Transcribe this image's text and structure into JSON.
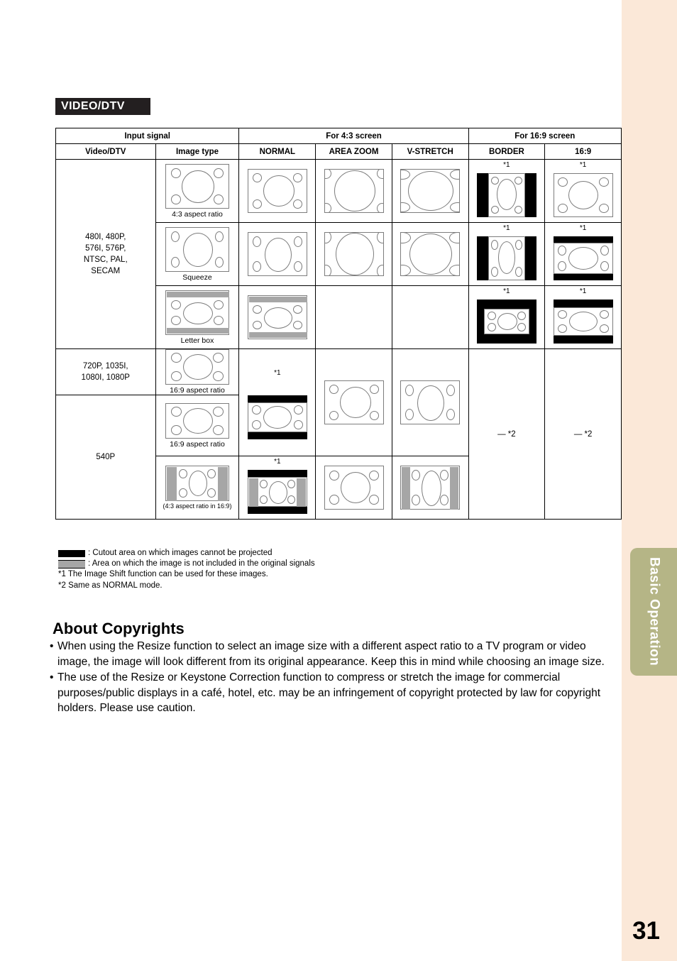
{
  "page": {
    "number": "31",
    "side_tab": "Basic Operation"
  },
  "section": {
    "title": "VIDEO/DTV"
  },
  "table": {
    "header_top": [
      "Input signal",
      "For 4:3 screen",
      "For 16:9 screen"
    ],
    "header_cols": [
      "Video/DTV",
      "Image type",
      "NORMAL",
      "AREA ZOOM",
      "V-STRETCH",
      "BORDER",
      "16:9"
    ],
    "groups": [
      {
        "signal": "480I, 480P,\n576I, 576P,\nNTSC, PAL,\nSECAM",
        "signal_lines": [
          "480I, 480P,",
          "576I, 576P,",
          "NTSC, PAL,",
          "SECAM"
        ],
        "rows": [
          {
            "image_type": "4:3 aspect ratio",
            "marks": {
              "border": "*1",
              "wide": "*1"
            }
          },
          {
            "image_type": "Squeeze",
            "marks": {
              "border": "*1",
              "wide": "*1"
            }
          },
          {
            "image_type": "Letter box",
            "marks": {
              "border": "*1",
              "wide": "*1"
            }
          }
        ]
      },
      {
        "signal_lines": [
          "720P, 1035I,",
          "1080I, 1080P"
        ],
        "rows": [
          {
            "image_type": "16:9 aspect ratio",
            "marks": {
              "normal": "*1"
            }
          }
        ]
      },
      {
        "signal_lines": [
          "540P"
        ],
        "rows": [
          {
            "image_type": "16:9 aspect ratio",
            "marks": {}
          },
          {
            "image_type": "(4:3 aspect ratio in 16:9)",
            "marks": {
              "normal": "*1"
            }
          }
        ]
      }
    ],
    "same_as_normal_border": "— *2",
    "same_as_normal_wide": "— *2"
  },
  "legend": {
    "black": ": Cutout area on which images cannot be projected",
    "gray": ": Area on which the image is not included in the original signals",
    "note1": "*1 The Image Shift function can be used for these images.",
    "note2": "*2 Same as NORMAL mode."
  },
  "copyrights": {
    "heading": "About Copyrights",
    "bullets": [
      "When using the Resize function to select an image size with a different aspect ratio to a TV program or video image, the image will look different from its original appearance. Keep this in mind while choosing an image size.",
      "The use of the Resize or Keystone Correction function to compress or stretch the image for commercial purposes/public displays in a café, hotel, etc. may be an infringement of copyright protected by law for copyright holders. Please use caution."
    ]
  },
  "colors": {
    "tab": "#b5b586",
    "strip": "#fbe8d8",
    "header_bar": "#231f20"
  }
}
